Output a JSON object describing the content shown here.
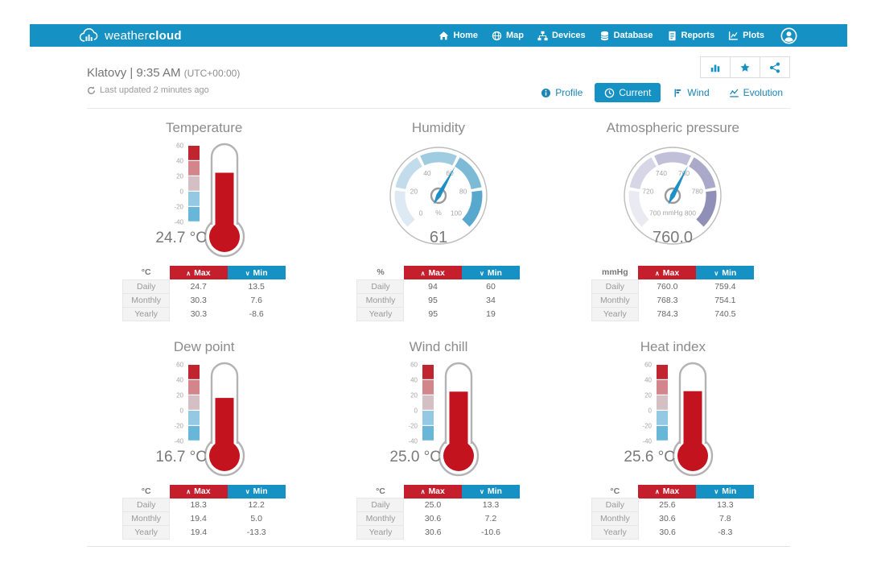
{
  "brand": {
    "weather": "weather",
    "cloud": "cloud"
  },
  "nav": [
    {
      "label": "Home",
      "icon": "home-icon"
    },
    {
      "label": "Map",
      "icon": "map-icon"
    },
    {
      "label": "Devices",
      "icon": "devices-icon"
    },
    {
      "label": "Database",
      "icon": "database-icon"
    },
    {
      "label": "Reports",
      "icon": "reports-icon"
    },
    {
      "label": "Plots",
      "icon": "plots-icon"
    }
  ],
  "station": {
    "title": "Klatovy | 9:35 AM",
    "utc": "(UTC+00:00)",
    "last_updated": "Last updated 2 minutes ago"
  },
  "action_buttons": [
    {
      "name": "stats",
      "icon": "bar-chart-icon"
    },
    {
      "name": "favorite",
      "icon": "star-icon"
    },
    {
      "name": "share",
      "icon": "share-icon"
    }
  ],
  "tabs": [
    {
      "label": "Profile",
      "icon": "info-icon",
      "active": false
    },
    {
      "label": "Current",
      "icon": "clock-icon",
      "active": true
    },
    {
      "label": "Wind",
      "icon": "wind-flag-icon",
      "active": false
    },
    {
      "label": "Evolution",
      "icon": "evolution-icon",
      "active": false
    }
  ],
  "table_common": {
    "max_label": "Max",
    "min_label": "Min"
  },
  "colors": {
    "navbar_blue": "#1591c3",
    "max_red": "#c51f2e",
    "min_blue": "#1591c3",
    "needle": "#1e8fc6",
    "thermo_fill": "#c2131f"
  },
  "chart_data": [
    {
      "type": "gauge-thermometer",
      "title": "Temperature",
      "unit": "°C",
      "value": 24.7,
      "display_value": "24.7 °C",
      "min": -40,
      "max": 60,
      "ticks": [
        60,
        40,
        20,
        0,
        -20,
        -40
      ],
      "segment_colors": [
        "#c0242e",
        "#d2858b",
        "#d3bfc4",
        "#93c9e2",
        "#68b7d8"
      ],
      "table": {
        "unit": "°C",
        "rows": [
          [
            "Daily",
            "24.7",
            "13.5"
          ],
          [
            "Monthly",
            "30.3",
            "7.6"
          ],
          [
            "Yearly",
            "30.3",
            "-8.6"
          ]
        ]
      }
    },
    {
      "type": "gauge-radial",
      "title": "Humidity",
      "unit": "%",
      "value": 61,
      "display_value": "61",
      "min": 0,
      "max": 100,
      "ticks": [
        0,
        20,
        40,
        60,
        80,
        100
      ],
      "segment_colors": [
        "#ddeaf3",
        "#c2dcec",
        "#a0cce1",
        "#7cbad6",
        "#58a7cd"
      ],
      "table": {
        "unit": "%",
        "rows": [
          [
            "Daily",
            "94",
            "60"
          ],
          [
            "Monthly",
            "95",
            "34"
          ],
          [
            "Yearly",
            "95",
            "19"
          ]
        ]
      }
    },
    {
      "type": "gauge-radial",
      "title": "Atmospheric pressure",
      "unit": "mmHg",
      "value": 760.0,
      "display_value": "760.0",
      "min": 700,
      "max": 800,
      "ticks": [
        700,
        720,
        740,
        760,
        780,
        800
      ],
      "segment_colors": [
        "#eaeaf2",
        "#d6d6e6",
        "#c1c0d8",
        "#aaa9c9",
        "#908fb8"
      ],
      "table": {
        "unit": "mmHg",
        "rows": [
          [
            "Daily",
            "760.0",
            "759.4"
          ],
          [
            "Monthly",
            "768.3",
            "754.1"
          ],
          [
            "Yearly",
            "784.3",
            "740.5"
          ]
        ]
      }
    },
    {
      "type": "gauge-thermometer",
      "title": "Dew point",
      "unit": "°C",
      "value": 16.7,
      "display_value": "16.7 °C",
      "min": -40,
      "max": 60,
      "ticks": [
        60,
        40,
        20,
        0,
        -20,
        -40
      ],
      "segment_colors": [
        "#c0242e",
        "#d2858b",
        "#d3bfc4",
        "#93c9e2",
        "#68b7d8"
      ],
      "table": {
        "unit": "°C",
        "rows": [
          [
            "Daily",
            "18.3",
            "12.2"
          ],
          [
            "Monthly",
            "19.4",
            "5.0"
          ],
          [
            "Yearly",
            "19.4",
            "-13.3"
          ]
        ]
      }
    },
    {
      "type": "gauge-thermometer",
      "title": "Wind chill",
      "unit": "°C",
      "value": 25.0,
      "display_value": "25.0 °C",
      "min": -40,
      "max": 60,
      "ticks": [
        60,
        40,
        20,
        0,
        -20,
        -40
      ],
      "segment_colors": [
        "#c0242e",
        "#d2858b",
        "#d3bfc4",
        "#93c9e2",
        "#68b7d8"
      ],
      "table": {
        "unit": "°C",
        "rows": [
          [
            "Daily",
            "25.0",
            "13.3"
          ],
          [
            "Monthly",
            "30.6",
            "7.2"
          ],
          [
            "Yearly",
            "30.6",
            "-10.6"
          ]
        ]
      }
    },
    {
      "type": "gauge-thermometer",
      "title": "Heat index",
      "unit": "°C",
      "value": 25.6,
      "display_value": "25.6 °C",
      "min": -40,
      "max": 60,
      "ticks": [
        60,
        40,
        20,
        0,
        -20,
        -40
      ],
      "segment_colors": [
        "#c0242e",
        "#d2858b",
        "#d3bfc4",
        "#93c9e2",
        "#68b7d8"
      ],
      "table": {
        "unit": "°C",
        "rows": [
          [
            "Daily",
            "25.6",
            "13.3"
          ],
          [
            "Monthly",
            "30.6",
            "7.8"
          ],
          [
            "Yearly",
            "30.6",
            "-8.3"
          ]
        ]
      }
    }
  ]
}
